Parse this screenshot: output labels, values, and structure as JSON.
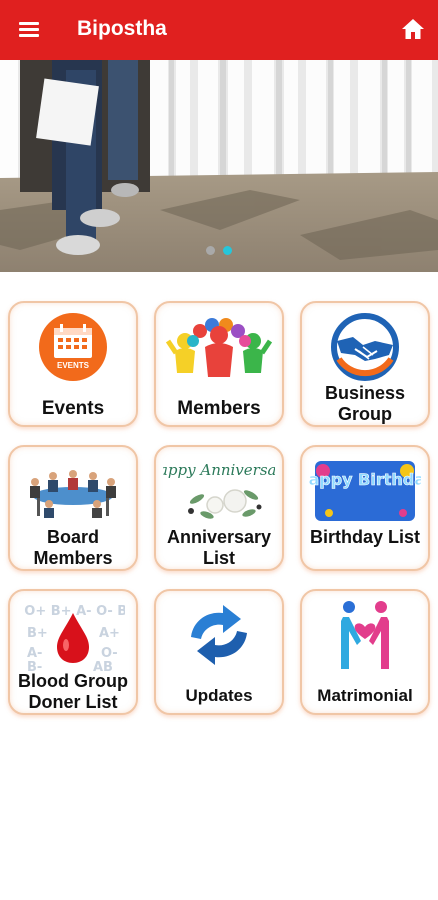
{
  "app_bar": {
    "title": "Bipostha",
    "menu_icon": "hamburger-menu-icon",
    "home_icon": "home-icon",
    "background": "#e0201f"
  },
  "banner": {
    "slide_count": 2,
    "active_slide": 2,
    "active_dot_color": "#26c6da"
  },
  "tiles": [
    {
      "label": "Events",
      "icon": "calendar-events-icon",
      "icon_text": "EVENTS"
    },
    {
      "label": "Members",
      "icon": "group-people-icon"
    },
    {
      "label": "Business Group",
      "icon": "handshake-icon"
    },
    {
      "label": "Board Members",
      "icon": "boardroom-meeting-icon"
    },
    {
      "label": "Anniversary List",
      "icon": "happy-anniversary-icon",
      "icon_text": "Happy Anniversary"
    },
    {
      "label": "Birthday List",
      "icon": "happy-birthday-icon",
      "icon_text": "Happy Birthday"
    },
    {
      "label": "Blood Group Doner List",
      "icon": "blood-drop-icon",
      "icon_text": "AB+ O+ B+ A- O- B- AB"
    },
    {
      "label": "Updates",
      "icon": "refresh-arrows-icon"
    },
    {
      "label": "Matrimonial",
      "icon": "couple-heart-icon"
    }
  ]
}
